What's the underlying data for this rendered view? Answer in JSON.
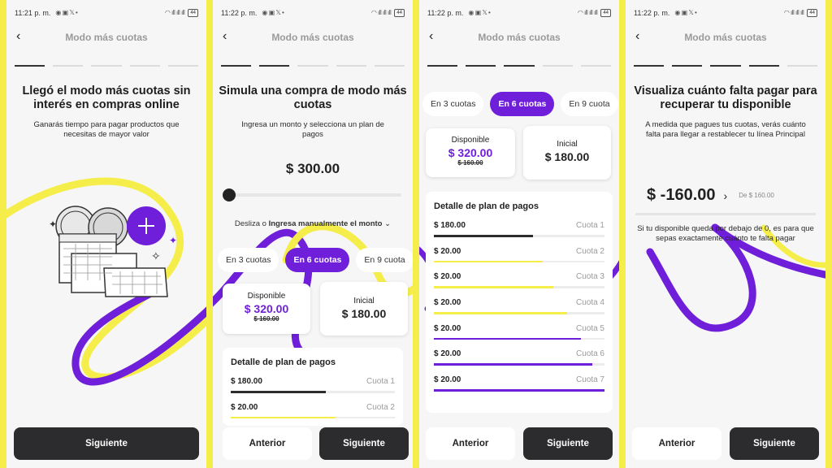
{
  "status_bar": [
    {
      "time": "11:21 p. m.",
      "battery": "44"
    },
    {
      "time": "11:22 p. m.",
      "battery": "44"
    },
    {
      "time": "11:22 p. m.",
      "battery": "44"
    },
    {
      "time": "11:22 p. m.",
      "battery": "44"
    }
  ],
  "header_title": "Modo más cuotas",
  "back_icon": "chevron-left-icon",
  "colors": {
    "accent_purple": "#6f1ed9",
    "accent_yellow": "#f5ee4a",
    "dark": "#2c2c2e"
  },
  "screen1": {
    "title": "Llegó el modo más cuotas sin interés en compras online",
    "subtitle": "Ganarás tiempo para pagar productos que necesitas de mayor valor",
    "next_button": "Siguiente",
    "progress_step": 1
  },
  "screen2": {
    "title": "Simula una compra de modo más cuotas",
    "subtitle": "Ingresa un monto y selecciona un plan de pagos",
    "amount": "$ 300.00",
    "slider_level": 0,
    "slide_hint_prefix": "Desliza o ",
    "slide_hint_link": "Ingresa manualmente el monto",
    "tabs": [
      "En 3 cuotas",
      "En 6 cuotas",
      "En 9 cuota"
    ],
    "selected_tab": 1,
    "disponible_label": "Disponible",
    "disponible_value": "$ 320.00",
    "disponible_strike": "$ 160.00",
    "inicial_label": "Inicial",
    "inicial_value": "$ 180.00",
    "detail_title": "Detalle de plan de pagos",
    "rows": [
      {
        "amount": "$ 180.00",
        "cuota": "Cuota 1"
      },
      {
        "amount": "$ 20.00",
        "cuota": "Cuota 2"
      }
    ],
    "prev_button": "Anterior",
    "next_button": "Siguiente",
    "progress_step": 2
  },
  "screen3": {
    "tabs": [
      "En 3 cuotas",
      "En 6 cuotas",
      "En 9 cuota"
    ],
    "selected_tab": 1,
    "disponible_label": "Disponible",
    "disponible_value": "$ 320.00",
    "disponible_strike": "$ 160.00",
    "inicial_label": "Inicial",
    "inicial_value": "$ 180.00",
    "detail_title": "Detalle de plan de pagos",
    "rows": [
      {
        "amount": "$ 180.00",
        "cuota": "Cuota 1"
      },
      {
        "amount": "$ 20.00",
        "cuota": "Cuota 2"
      },
      {
        "amount": "$ 20.00",
        "cuota": "Cuota 3"
      },
      {
        "amount": "$ 20.00",
        "cuota": "Cuota 4"
      },
      {
        "amount": "$ 20.00",
        "cuota": "Cuota 5"
      },
      {
        "amount": "$ 20.00",
        "cuota": "Cuota 6"
      },
      {
        "amount": "$ 20.00",
        "cuota": "Cuota 7"
      }
    ],
    "prev_button": "Anterior",
    "next_button": "Siguiente",
    "progress_step": 3
  },
  "screen4": {
    "title": "Visualiza cuánto falta pagar para recuperar tu disponible",
    "subtitle": "A medida que pagues tus cuotas, verás cuánto falta para llegar a restablecer tu línea Principal",
    "balance": "$ -160.00",
    "balance_of": "De $ 160.00",
    "note": "Si tu disponible queda por debajo de 0, es para que sepas exactamente cuánto te falta pagar",
    "prev_button": "Anterior",
    "next_button": "Siguiente",
    "progress_step": 4
  }
}
